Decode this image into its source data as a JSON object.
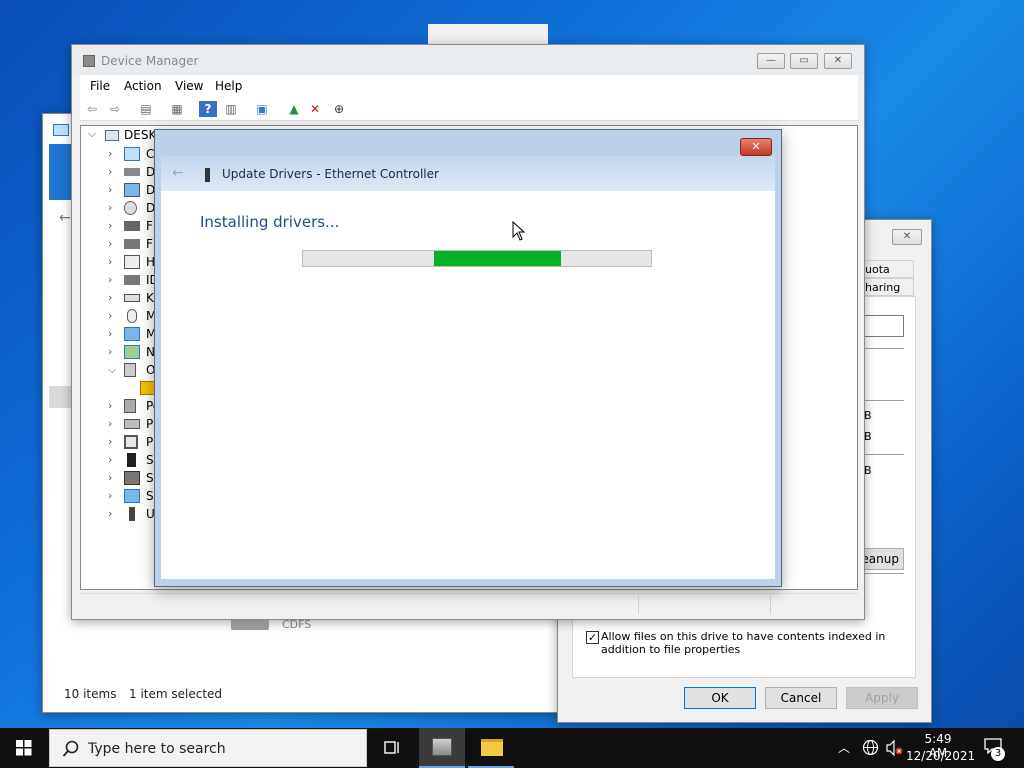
{
  "device_manager": {
    "title": "Device Manager",
    "menu": [
      "File",
      "Action",
      "View",
      "Help"
    ],
    "tree_root": "DESKT",
    "tree_items": [
      "Co",
      "Di",
      "Di",
      "DV",
      "Fl",
      "Fl",
      "Hu",
      "ID",
      "Ke",
      "M",
      "M",
      "Ne",
      "Ot",
      "",
      "Po",
      "Pr",
      "Pr",
      "So",
      "St",
      "Sy",
      "Ur"
    ]
  },
  "update_dialog": {
    "title": "Update Drivers - Ethernet Controller",
    "status": "Installing drivers...",
    "progress": 0.36,
    "close_label": "✕"
  },
  "explorer": {
    "status_items": "10 items",
    "status_selected": "1 item selected",
    "drive_label": "CDFS"
  },
  "properties": {
    "tab_quota": "uota",
    "tab_sharing": "haring",
    "cleanup_label": "eanup",
    "index_checkbox_label": "Allow files on this drive to have contents indexed in addition to file properties",
    "index_checked": true,
    "ok_label": "OK",
    "cancel_label": "Cancel",
    "apply_label": "Apply",
    "partial_b1": "B",
    "partial_b2": "B",
    "partial_b3": "B"
  },
  "taskbar": {
    "search_placeholder": "Type here to search",
    "time": "5:49 AM",
    "date": "12/20/2021",
    "notification_count": "3"
  },
  "colors": {
    "progress_fill": "#06b025",
    "dialog_frame": "#bcd0e8",
    "link_blue": "#1e4e8c",
    "taskbar": "#101010"
  }
}
